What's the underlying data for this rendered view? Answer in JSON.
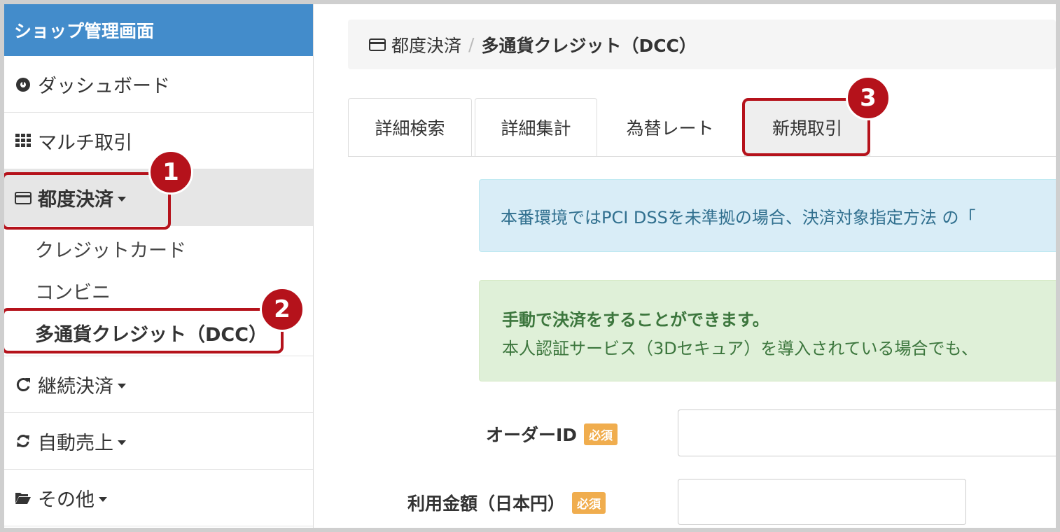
{
  "sidebar": {
    "title": "ショップ管理画面",
    "items": [
      {
        "label": "ダッシュボード",
        "icon": "dashboard-icon"
      },
      {
        "label": "マルチ取引",
        "icon": "grid-icon"
      },
      {
        "label": "都度決済",
        "icon": "credit-card-icon"
      },
      {
        "label": "継続決済",
        "icon": "refresh-icon"
      },
      {
        "label": "自動売上",
        "icon": "sync-icon"
      },
      {
        "label": "その他",
        "icon": "folder-open-icon"
      }
    ],
    "sub_items": [
      "クレジットカード",
      "コンビニ",
      "多通貨クレジット（DCC）"
    ]
  },
  "breadcrumb": {
    "parent": "都度決済",
    "separator": "/",
    "current": "多通貨クレジット（DCC）"
  },
  "tabs": [
    "詳細検索",
    "詳細集計",
    "為替レート",
    "新規取引"
  ],
  "alerts": {
    "info": "本番環境ではPCI DSSを未準拠の場合、決済対象指定方法 の「",
    "success_title": "手動で決済をすることができます。",
    "success_body": "本人認証サービス（3Dセキュア）を導入されている場合でも、"
  },
  "form": {
    "order_id_label": "オーダーID",
    "amount_label": "利用金額（日本円）",
    "required_badge": "必須",
    "order_id_value": "",
    "amount_value": ""
  },
  "callouts": [
    "1",
    "2",
    "3"
  ],
  "colors": {
    "header": "#438ccb",
    "callout": "#b5121b",
    "required": "#f0ad4e"
  }
}
